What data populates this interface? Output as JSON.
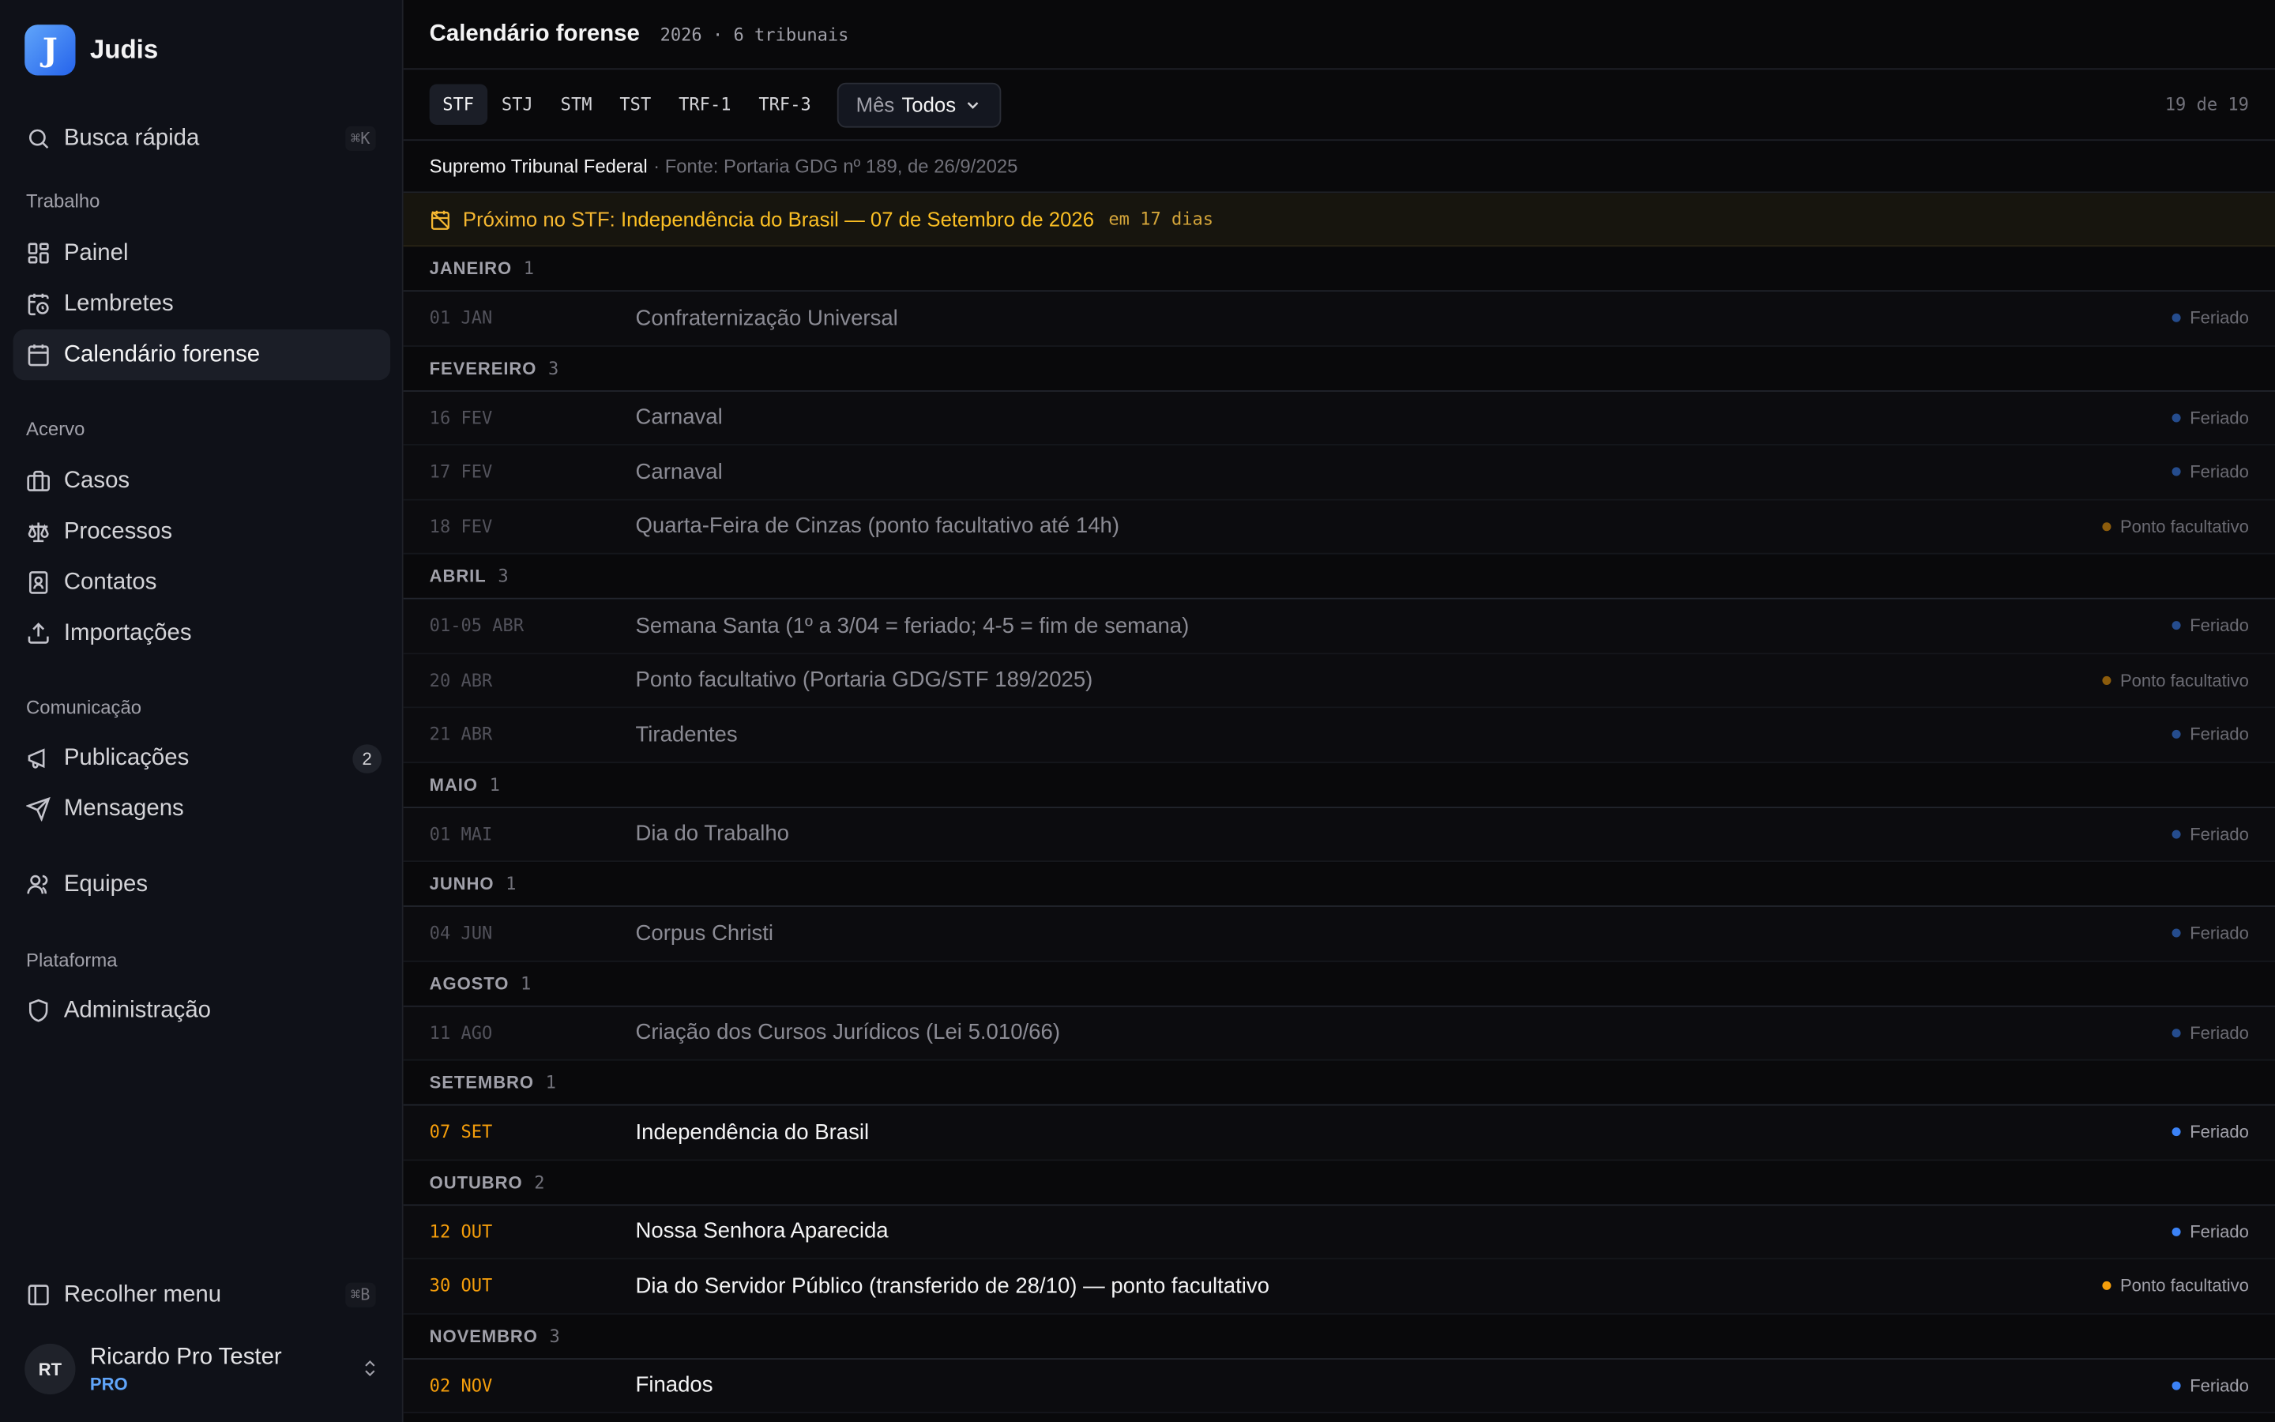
{
  "sidebar": {
    "brand": {
      "logo_letter": "J",
      "name": "Judis"
    },
    "search": {
      "label": "Busca rápida",
      "shortcut": "⌘K"
    },
    "sections": {
      "trabalho": "Trabalho",
      "acervo": "Acervo",
      "comunicacao": "Comunicação",
      "plataforma": "Plataforma"
    },
    "items": {
      "painel": "Painel",
      "lembretes": "Lembretes",
      "calendario": "Calendário forense",
      "casos": "Casos",
      "processos": "Processos",
      "contatos": "Contatos",
      "importacoes": "Importações",
      "publicacoes": "Publicações",
      "publicacoes_count": "2",
      "mensagens": "Mensagens",
      "equipes": "Equipes",
      "administracao": "Administração"
    },
    "collapse": {
      "label": "Recolher menu",
      "shortcut": "⌘B"
    },
    "user": {
      "initials": "RT",
      "name": "Ricardo Pro Tester",
      "plan": "PRO"
    }
  },
  "header": {
    "title": "Calendário forense",
    "subtitle": "2026 · 6 tribunais"
  },
  "tabs": [
    "STF",
    "STJ",
    "STM",
    "TST",
    "TRF-1",
    "TRF-3"
  ],
  "active_tab": "STF",
  "month_filter": {
    "label": "Mês",
    "value": "Todos"
  },
  "counter": "19 de 19",
  "source": {
    "court": "Supremo Tribunal Federal",
    "ref": "· Fonte: Portaria GDG nº 189, de 26/9/2025"
  },
  "next_event": {
    "prefix": "Próximo no STF: ",
    "name": "Independência do Brasil",
    "date": " — 07 de Setembro de 2026",
    "days": "em 17 dias"
  },
  "colors": {
    "accent": "#3b82f6",
    "holiday_dot": "#3b82f6",
    "optional_dot": "#f59e0b",
    "upcoming_date": "#f59e0b"
  },
  "months": [
    {
      "name": "JANEIRO",
      "count": "1",
      "events": [
        {
          "date": "01 JAN",
          "title": "Confraternização Universal",
          "type": "Feriado",
          "kind": "holiday",
          "upcoming": false
        }
      ]
    },
    {
      "name": "FEVEREIRO",
      "count": "3",
      "events": [
        {
          "date": "16 FEV",
          "title": "Carnaval",
          "type": "Feriado",
          "kind": "holiday",
          "upcoming": false
        },
        {
          "date": "17 FEV",
          "title": "Carnaval",
          "type": "Feriado",
          "kind": "holiday",
          "upcoming": false
        },
        {
          "date": "18 FEV",
          "title": "Quarta-Feira de Cinzas (ponto facultativo até 14h)",
          "type": "Ponto facultativo",
          "kind": "optional",
          "upcoming": false
        }
      ]
    },
    {
      "name": "ABRIL",
      "count": "3",
      "events": [
        {
          "date": "01-05 ABR",
          "title": "Semana Santa (1º a 3/04 = feriado; 4-5 = fim de semana)",
          "type": "Feriado",
          "kind": "holiday",
          "upcoming": false
        },
        {
          "date": "20 ABR",
          "title": "Ponto facultativo (Portaria GDG/STF 189/2025)",
          "type": "Ponto facultativo",
          "kind": "optional",
          "upcoming": false
        },
        {
          "date": "21 ABR",
          "title": "Tiradentes",
          "type": "Feriado",
          "kind": "holiday",
          "upcoming": false
        }
      ]
    },
    {
      "name": "MAIO",
      "count": "1",
      "events": [
        {
          "date": "01 MAI",
          "title": "Dia do Trabalho",
          "type": "Feriado",
          "kind": "holiday",
          "upcoming": false
        }
      ]
    },
    {
      "name": "JUNHO",
      "count": "1",
      "events": [
        {
          "date": "04 JUN",
          "title": "Corpus Christi",
          "type": "Feriado",
          "kind": "holiday",
          "upcoming": false
        }
      ]
    },
    {
      "name": "AGOSTO",
      "count": "1",
      "events": [
        {
          "date": "11 AGO",
          "title": "Criação dos Cursos Jurídicos (Lei 5.010/66)",
          "type": "Feriado",
          "kind": "holiday",
          "upcoming": false
        }
      ]
    },
    {
      "name": "SETEMBRO",
      "count": "1",
      "events": [
        {
          "date": "07 SET",
          "title": "Independência do Brasil",
          "type": "Feriado",
          "kind": "holiday",
          "upcoming": true
        }
      ]
    },
    {
      "name": "OUTUBRO",
      "count": "2",
      "events": [
        {
          "date": "12 OUT",
          "title": "Nossa Senhora Aparecida",
          "type": "Feriado",
          "kind": "holiday",
          "upcoming": true
        },
        {
          "date": "30 OUT",
          "title": "Dia do Servidor Público (transferido de 28/10) — ponto facultativo",
          "type": "Ponto facultativo",
          "kind": "optional",
          "upcoming": true
        }
      ]
    },
    {
      "name": "NOVEMBRO",
      "count": "3",
      "events": [
        {
          "date": "02 NOV",
          "title": "Finados",
          "type": "Feriado",
          "kind": "holiday",
          "upcoming": true
        }
      ]
    }
  ]
}
